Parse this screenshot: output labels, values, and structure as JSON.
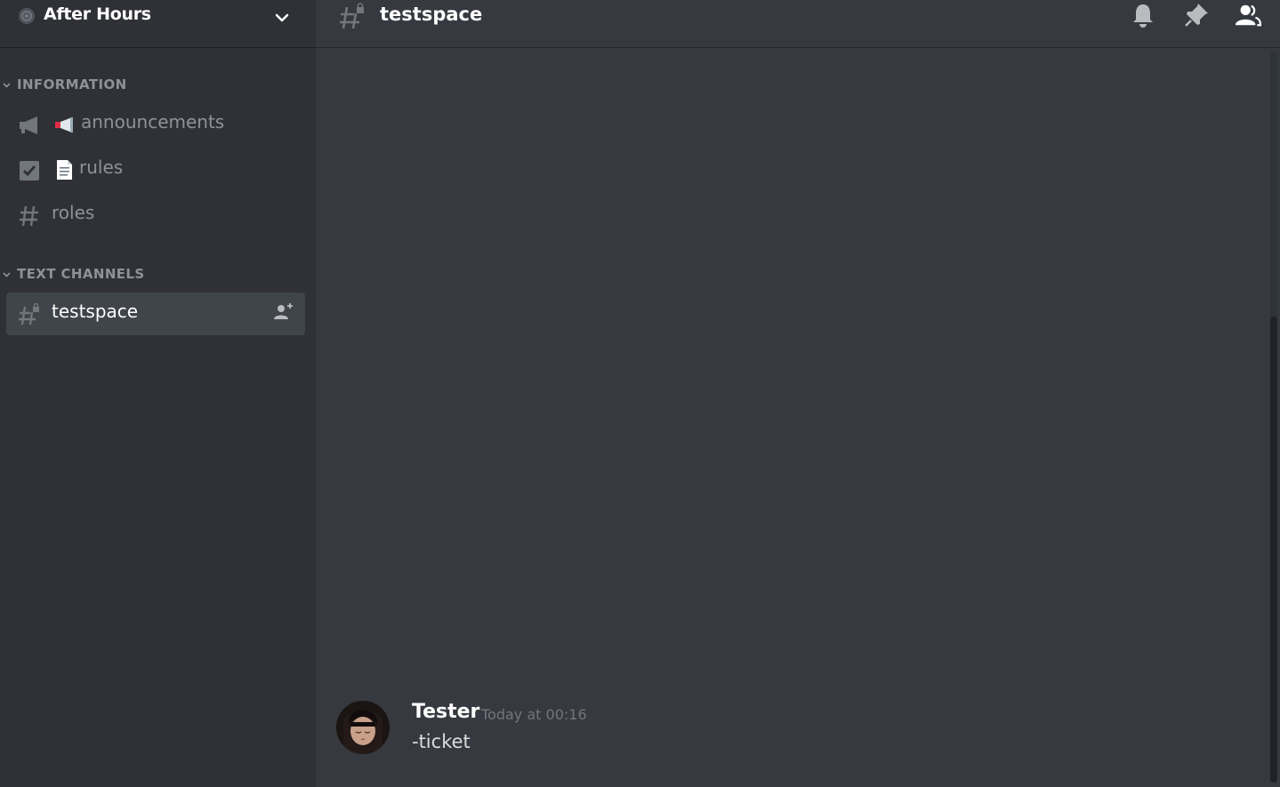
{
  "server": {
    "name": "After Hours"
  },
  "sidebar": {
    "categories": [
      {
        "label": "INFORMATION",
        "channels": [
          {
            "label": "announcements",
            "icon": "megaphone-icon",
            "emoji": "megaphone-emoji"
          },
          {
            "label": "rules",
            "icon": "checkbox-icon",
            "emoji": "page-emoji"
          },
          {
            "label": "roles",
            "icon": "hash-icon"
          }
        ]
      },
      {
        "label": "TEXT CHANNELS",
        "channels": [
          {
            "label": "testspace",
            "icon": "locked-hash-icon",
            "active": true
          }
        ]
      }
    ]
  },
  "topbar": {
    "channel": "testspace",
    "icons": [
      "bell-icon",
      "pin-icon",
      "members-icon"
    ]
  },
  "messages": [
    {
      "author": "Tester",
      "timestamp": "Today at 00:16",
      "content": "-ticket"
    }
  ],
  "colors": {
    "sidebar": "#2f3136",
    "chat": "#36393f",
    "active_channel": "#40444b",
    "muted_text": "#8e9297",
    "timestamp": "#72767d"
  }
}
